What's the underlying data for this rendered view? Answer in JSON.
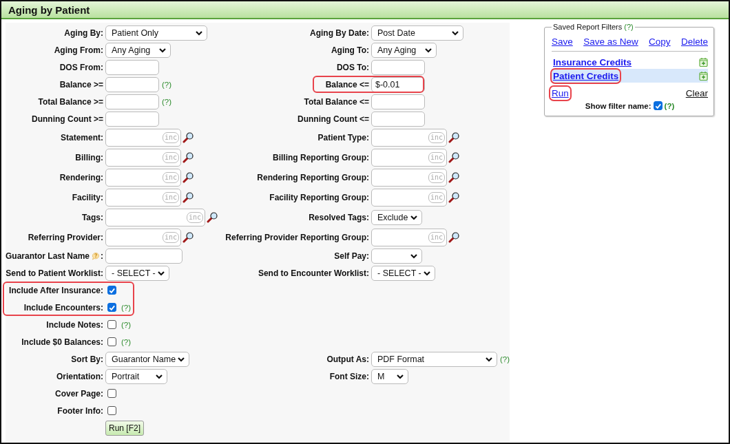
{
  "title": "Aging by Patient",
  "form": {
    "rows": [
      {
        "left": {
          "kind": "select",
          "label": "Aging By:",
          "value": "Patient Only"
        },
        "right": {
          "kind": "select",
          "label": "Aging By Date:",
          "value": "Post Date"
        }
      },
      {
        "left": {
          "kind": "select",
          "label": "Aging From:",
          "value": "Any Aging"
        },
        "right": {
          "kind": "select",
          "label": "Aging To:",
          "value": "Any Aging"
        }
      },
      {
        "left": {
          "kind": "text",
          "label": "DOS From:"
        },
        "right": {
          "kind": "text",
          "label": "DOS To:"
        }
      },
      {
        "left": {
          "kind": "text",
          "label": "Balance >=",
          "help": "(?)"
        },
        "right": {
          "kind": "text",
          "label": "Balance <=",
          "value": "$-0.01",
          "highlighted": true
        }
      },
      {
        "left": {
          "kind": "text",
          "label": "Total Balance >=",
          "help": "(?)"
        },
        "right": {
          "kind": "text",
          "label": "Total Balance <="
        }
      },
      {
        "left": {
          "kind": "text",
          "label": "Dunning Count >="
        },
        "right": {
          "kind": "text",
          "label": "Dunning Count <="
        }
      },
      {
        "left": {
          "kind": "lookup",
          "label": "Statement:",
          "badge": "inc"
        },
        "right": {
          "kind": "lookup",
          "label": "Patient Type:",
          "badge": "inc"
        }
      },
      {
        "left": {
          "kind": "lookup",
          "label": "Billing:",
          "badge": "inc"
        },
        "right": {
          "kind": "lookup",
          "label": "Billing Reporting Group:",
          "badge": "inc"
        }
      },
      {
        "left": {
          "kind": "lookup",
          "label": "Rendering:",
          "badge": "inc"
        },
        "right": {
          "kind": "lookup",
          "label": "Rendering Reporting Group:",
          "badge": "inc"
        }
      },
      {
        "left": {
          "kind": "lookup",
          "label": "Facility:",
          "badge": "inc"
        },
        "right": {
          "kind": "lookup",
          "label": "Facility Reporting Group:",
          "badge": "inc"
        }
      },
      {
        "left": {
          "kind": "lookup",
          "label": "Tags:",
          "badge": "inc"
        },
        "right": {
          "kind": "select",
          "label": "Resolved Tags:",
          "value": "Exclude"
        }
      },
      {
        "left": {
          "kind": "lookup",
          "label": "Referring Provider:",
          "badge": "inc"
        },
        "right": {
          "kind": "lookup",
          "label": "Referring Provider Reporting Group:",
          "badge": "inc"
        }
      },
      {
        "left": {
          "kind": "text",
          "label": "Guarantor Last Name",
          "tip_icon": true,
          "label_end": ":"
        },
        "right": {
          "kind": "select",
          "label": "Self Pay:"
        }
      },
      {
        "left": {
          "kind": "select",
          "label": "Send to Patient Worklist:",
          "value": "- SELECT -"
        },
        "right": {
          "kind": "select",
          "label": "Send to Encounter Worklist:",
          "value": "- SELECT -"
        }
      },
      {
        "left": {
          "kind": "checkbox",
          "label": "Include After Insurance:",
          "checked": true,
          "highlighted": true
        }
      },
      {
        "left": {
          "kind": "checkbox",
          "label": "Include Encounters:",
          "checked": true,
          "help": "(?)",
          "highlighted": true
        }
      },
      {
        "left": {
          "kind": "checkbox",
          "label": "Include Notes:",
          "checked": false,
          "help": "(?)"
        }
      },
      {
        "left": {
          "kind": "checkbox",
          "label": "Include $0 Balances:",
          "checked": false,
          "help": "(?)"
        }
      },
      {
        "left": {
          "kind": "select",
          "label": "Sort By:",
          "value": "Guarantor Name"
        },
        "right": {
          "kind": "select",
          "label": "Output As:",
          "value": "PDF Format",
          "help": "(?)"
        }
      },
      {
        "left": {
          "kind": "select",
          "label": "Orientation:",
          "value": "Portrait"
        },
        "right": {
          "kind": "select",
          "label": "Font Size:",
          "value": "M"
        }
      },
      {
        "left": {
          "kind": "checkbox",
          "label": "Cover Page:",
          "checked": false
        }
      },
      {
        "left": {
          "kind": "checkbox",
          "label": "Footer Info:",
          "checked": false
        }
      }
    ],
    "run_button": "Run [F2]"
  },
  "saved_filters": {
    "legend": "Saved Report Filters",
    "legend_help": "(?)",
    "actions": [
      "Save",
      "Save as New",
      "Copy",
      "Delete"
    ],
    "filters": [
      {
        "name": "Insurance Credits",
        "selected": false,
        "highlighted": false
      },
      {
        "name": "Patient Credits",
        "selected": true,
        "highlighted": true
      }
    ],
    "run": {
      "label": "Run",
      "highlighted": true
    },
    "clear": "Clear",
    "show_name": {
      "label": "Show filter name:",
      "checked": true,
      "help": "(?)"
    }
  }
}
